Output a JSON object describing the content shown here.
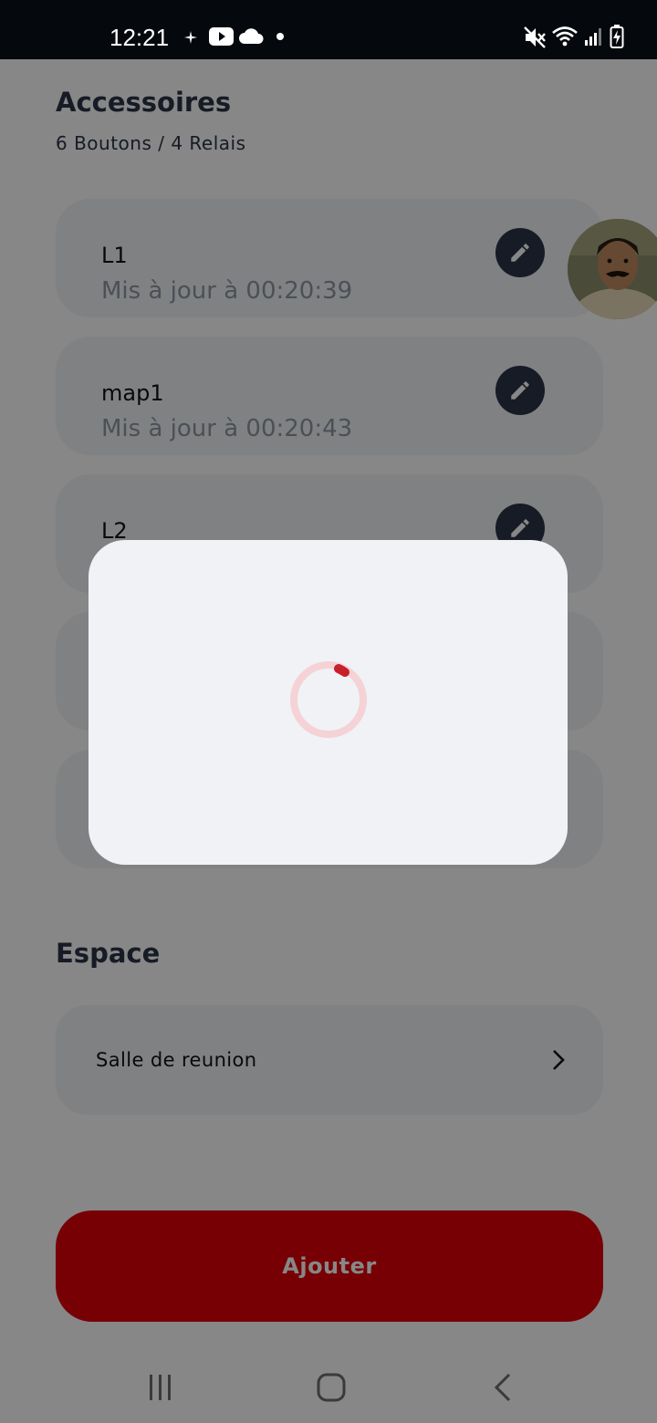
{
  "status_bar": {
    "time": "12:21",
    "icons": [
      "plus-sparkle-icon",
      "youtube-icon",
      "cloud-icon",
      "dot-icon",
      "mute-icon",
      "wifi-icon",
      "signal-icon",
      "battery-charging-icon"
    ]
  },
  "accessories": {
    "title": "Accessoires",
    "subtitle": "6 Boutons / 4 Relais",
    "items": [
      {
        "name": "L1",
        "updated": "Mis à jour à 00:20:39"
      },
      {
        "name": "map1",
        "updated": "Mis à jour à 00:20:43"
      },
      {
        "name": "L2",
        "updated": ""
      },
      {
        "name": "",
        "updated": ""
      },
      {
        "name": "",
        "updated": ""
      }
    ]
  },
  "space": {
    "title": "Espace",
    "room": "Salle de reunion"
  },
  "actions": {
    "add_label": "Ajouter"
  },
  "loading_dialog": {
    "spinner_color": "#c8202a",
    "track_color": "#f5d2d6"
  },
  "colors": {
    "primary_dark": "#2a3446",
    "accent_red": "#e0000a",
    "card_bg": "#f1f3f7"
  },
  "nav_bar": {
    "icons": [
      "recent-apps-icon",
      "home-icon",
      "back-icon"
    ]
  }
}
